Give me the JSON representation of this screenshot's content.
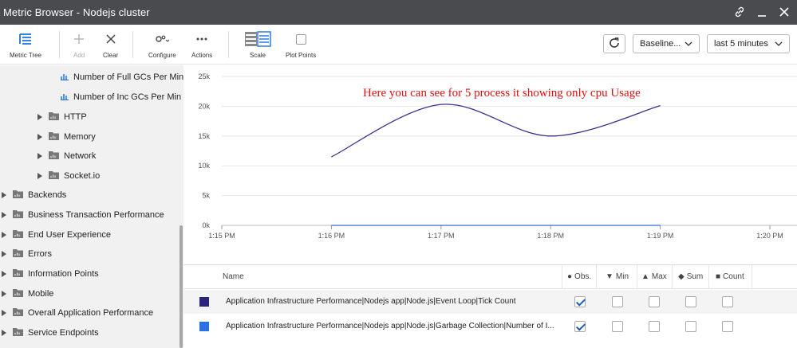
{
  "window": {
    "title": "Metric Browser - Nodejs cluster"
  },
  "toolbar": {
    "metric_tree": "Metric Tree",
    "add": "Add",
    "clear": "Clear",
    "configure": "Configure",
    "actions": "Actions",
    "scale": "Scale",
    "plot_points": "Plot Points",
    "baseline": "Baseline...",
    "time_range": "last 5 minutes"
  },
  "tree": {
    "items": [
      {
        "label": "Number of Full GCs Per Min",
        "type": "metric"
      },
      {
        "label": "Number of Inc GCs Per Min",
        "type": "metric"
      },
      {
        "label": "HTTP",
        "type": "folder"
      },
      {
        "label": "Memory",
        "type": "folder"
      },
      {
        "label": "Network",
        "type": "folder"
      },
      {
        "label": "Socket.io",
        "type": "folder"
      },
      {
        "label": "Backends",
        "type": "folder"
      },
      {
        "label": "Business Transaction Performance",
        "type": "folder"
      },
      {
        "label": "End User Experience",
        "type": "folder"
      },
      {
        "label": "Errors",
        "type": "folder"
      },
      {
        "label": "Information Points",
        "type": "folder"
      },
      {
        "label": "Mobile",
        "type": "folder"
      },
      {
        "label": "Overall Application Performance",
        "type": "folder"
      },
      {
        "label": "Service Endpoints",
        "type": "folder"
      }
    ]
  },
  "annotation": "Here you can see for 5 process it showing only cpu Usage",
  "chart_data": {
    "type": "line",
    "x_ticks": [
      "1:15 PM",
      "1:16 PM",
      "1:17 PM",
      "1:18 PM",
      "1:19 PM",
      "1:20 PM"
    ],
    "y_ticks": [
      "25k",
      "20k",
      "15k",
      "10k",
      "5k",
      "0k"
    ],
    "ylim": [
      0,
      25000
    ],
    "series": [
      {
        "color": "#3a2f8f",
        "x": [
          "1:16 PM",
          "1:17 PM",
          "1:18 PM",
          "1:19 PM"
        ],
        "values": [
          11500,
          20300,
          15000,
          20100
        ]
      },
      {
        "color": "#2f6fd6",
        "x": [
          "1:16 PM",
          "1:17 PM",
          "1:18 PM",
          "1:19 PM"
        ],
        "values": [
          0,
          0,
          0,
          0
        ]
      }
    ]
  },
  "table": {
    "headers": {
      "name": "Name",
      "obs": "Obs.",
      "min": "Min",
      "max": "Max",
      "sum": "Sum",
      "count": "Count"
    },
    "rows": [
      {
        "name": "Application Infrastructure Performance|Nodejs app|Node.js|Event Loop|Tick Count",
        "color": "#2e2380",
        "obs": true,
        "min": false,
        "max": false,
        "sum": false,
        "count": false
      },
      {
        "name": "Application Infrastructure Performance|Nodejs app|Node.js|Garbage Collection|Number of I...",
        "color": "#2c6fe0",
        "obs": true,
        "min": false,
        "max": false,
        "sum": false,
        "count": false
      }
    ]
  }
}
